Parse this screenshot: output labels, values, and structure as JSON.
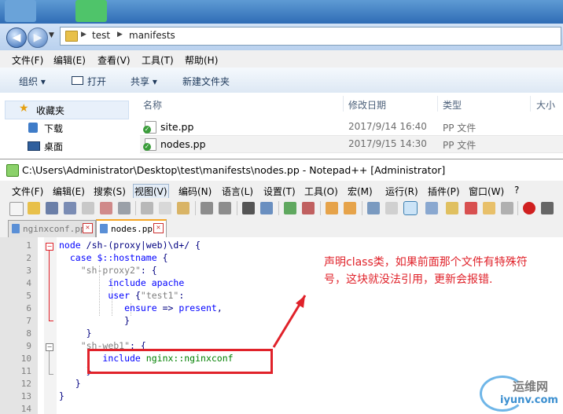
{
  "explorer": {
    "address": [
      "test",
      "manifests"
    ],
    "menu": [
      "文件(F)",
      "编辑(E)",
      "查看(V)",
      "工具(T)",
      "帮助(H)"
    ],
    "toolbar": {
      "organize": "组织 ▾",
      "open": "打开",
      "share": "共享 ▾",
      "new_folder": "新建文件夹"
    },
    "nav": [
      "收藏夹",
      "下载",
      "桌面"
    ],
    "columns": [
      "名称",
      "修改日期",
      "类型",
      "大小"
    ],
    "files": [
      {
        "name": "site.pp",
        "date": "2017/9/14 16:40",
        "type": "PP 文件"
      },
      {
        "name": "nodes.pp",
        "date": "2017/9/15 14:30",
        "type": "PP 文件"
      }
    ]
  },
  "npp": {
    "title": "C:\\Users\\Administrator\\Desktop\\test\\manifests\\nodes.pp - Notepad++ [Administrator]",
    "menu": [
      "文件(F)",
      "编辑(E)",
      "搜索(S)",
      "视图(V)",
      "编码(N)",
      "语言(L)",
      "设置(T)",
      "工具(O)",
      "宏(M)",
      "运行(R)",
      "插件(P)",
      "窗口(W)",
      "?"
    ],
    "tabs": [
      "nginxconf.pp",
      "nodes.pp"
    ],
    "line_numbers": [
      "1",
      "2",
      "3",
      "4",
      "5",
      "6",
      "7",
      "8",
      "9",
      "10",
      "11",
      "12",
      "13",
      "14"
    ]
  },
  "annotation": {
    "line1": "声明class类，如果前面那个文件有特殊符",
    "line2": "号，这块就没法引用，更新会报错."
  },
  "watermark": {
    "name": "运维网",
    "url": "iyunv.com"
  },
  "colors": {
    "accent_red": "#e0222a",
    "keyword_blue": "#0000ff",
    "string_grey": "#808080",
    "include_green": "#008000"
  }
}
